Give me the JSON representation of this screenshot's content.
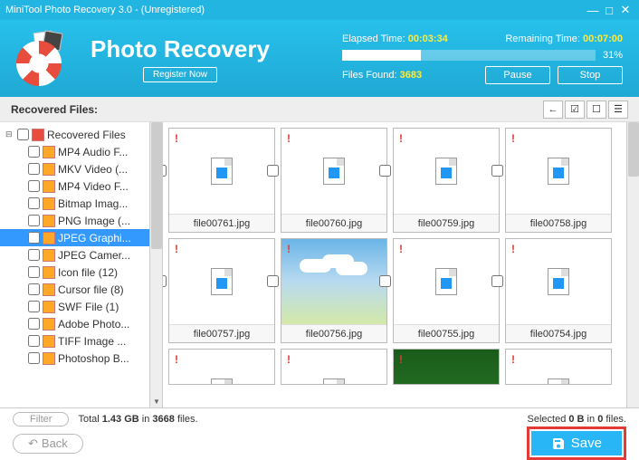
{
  "window": {
    "title": "MiniTool Photo Recovery 3.0 - (Unregistered)"
  },
  "header": {
    "appName": "Photo Recovery",
    "register": "Register Now",
    "elapsedLabel": "Elapsed Time:",
    "elapsedValue": "00:03:34",
    "remainingLabel": "Remaining Time:",
    "remainingValue": "00:07:00",
    "progressPct": "31%",
    "progressWidth": 31,
    "filesFoundLabel": "Files Found:",
    "filesFoundValue": "3683",
    "pause": "Pause",
    "stop": "Stop"
  },
  "subheader": {
    "title": "Recovered Files:"
  },
  "tree": {
    "root": "Recovered Files",
    "items": [
      {
        "label": "MP4 Audio F..."
      },
      {
        "label": "MKV Video (..."
      },
      {
        "label": "MP4 Video F..."
      },
      {
        "label": "Bitmap Imag..."
      },
      {
        "label": "PNG Image (..."
      },
      {
        "label": "JPEG Graphi...",
        "selected": true
      },
      {
        "label": "JPEG Camer..."
      },
      {
        "label": "Icon file (12)"
      },
      {
        "label": "Cursor file (8)"
      },
      {
        "label": "SWF File (1)"
      },
      {
        "label": "Adobe Photo..."
      },
      {
        "label": "TIFF Image ..."
      },
      {
        "label": "Photoshop B..."
      }
    ]
  },
  "thumbs": [
    [
      {
        "name": "file00761.jpg",
        "kind": "icon"
      },
      {
        "name": "file00760.jpg",
        "kind": "icon"
      },
      {
        "name": "file00759.jpg",
        "kind": "icon"
      },
      {
        "name": "file00758.jpg",
        "kind": "icon"
      }
    ],
    [
      {
        "name": "file00757.jpg",
        "kind": "icon"
      },
      {
        "name": "file00756.jpg",
        "kind": "sky"
      },
      {
        "name": "file00755.jpg",
        "kind": "icon"
      },
      {
        "name": "file00754.jpg",
        "kind": "icon"
      }
    ],
    [
      {
        "name": "",
        "kind": "icon"
      },
      {
        "name": "",
        "kind": "icon"
      },
      {
        "name": "",
        "kind": "leaf"
      },
      {
        "name": "",
        "kind": "icon"
      }
    ]
  ],
  "footer": {
    "filter": "Filter",
    "totalPrefix": "Total ",
    "totalSize": "1.43 GB",
    "totalMid": " in ",
    "totalCount": "3668",
    "totalSuffix": " files.",
    "selPrefix": "Selected ",
    "selSize": "0 B",
    "selMid": " in ",
    "selCount": "0",
    "selSuffix": " files.",
    "back": "Back",
    "save": "Save"
  }
}
